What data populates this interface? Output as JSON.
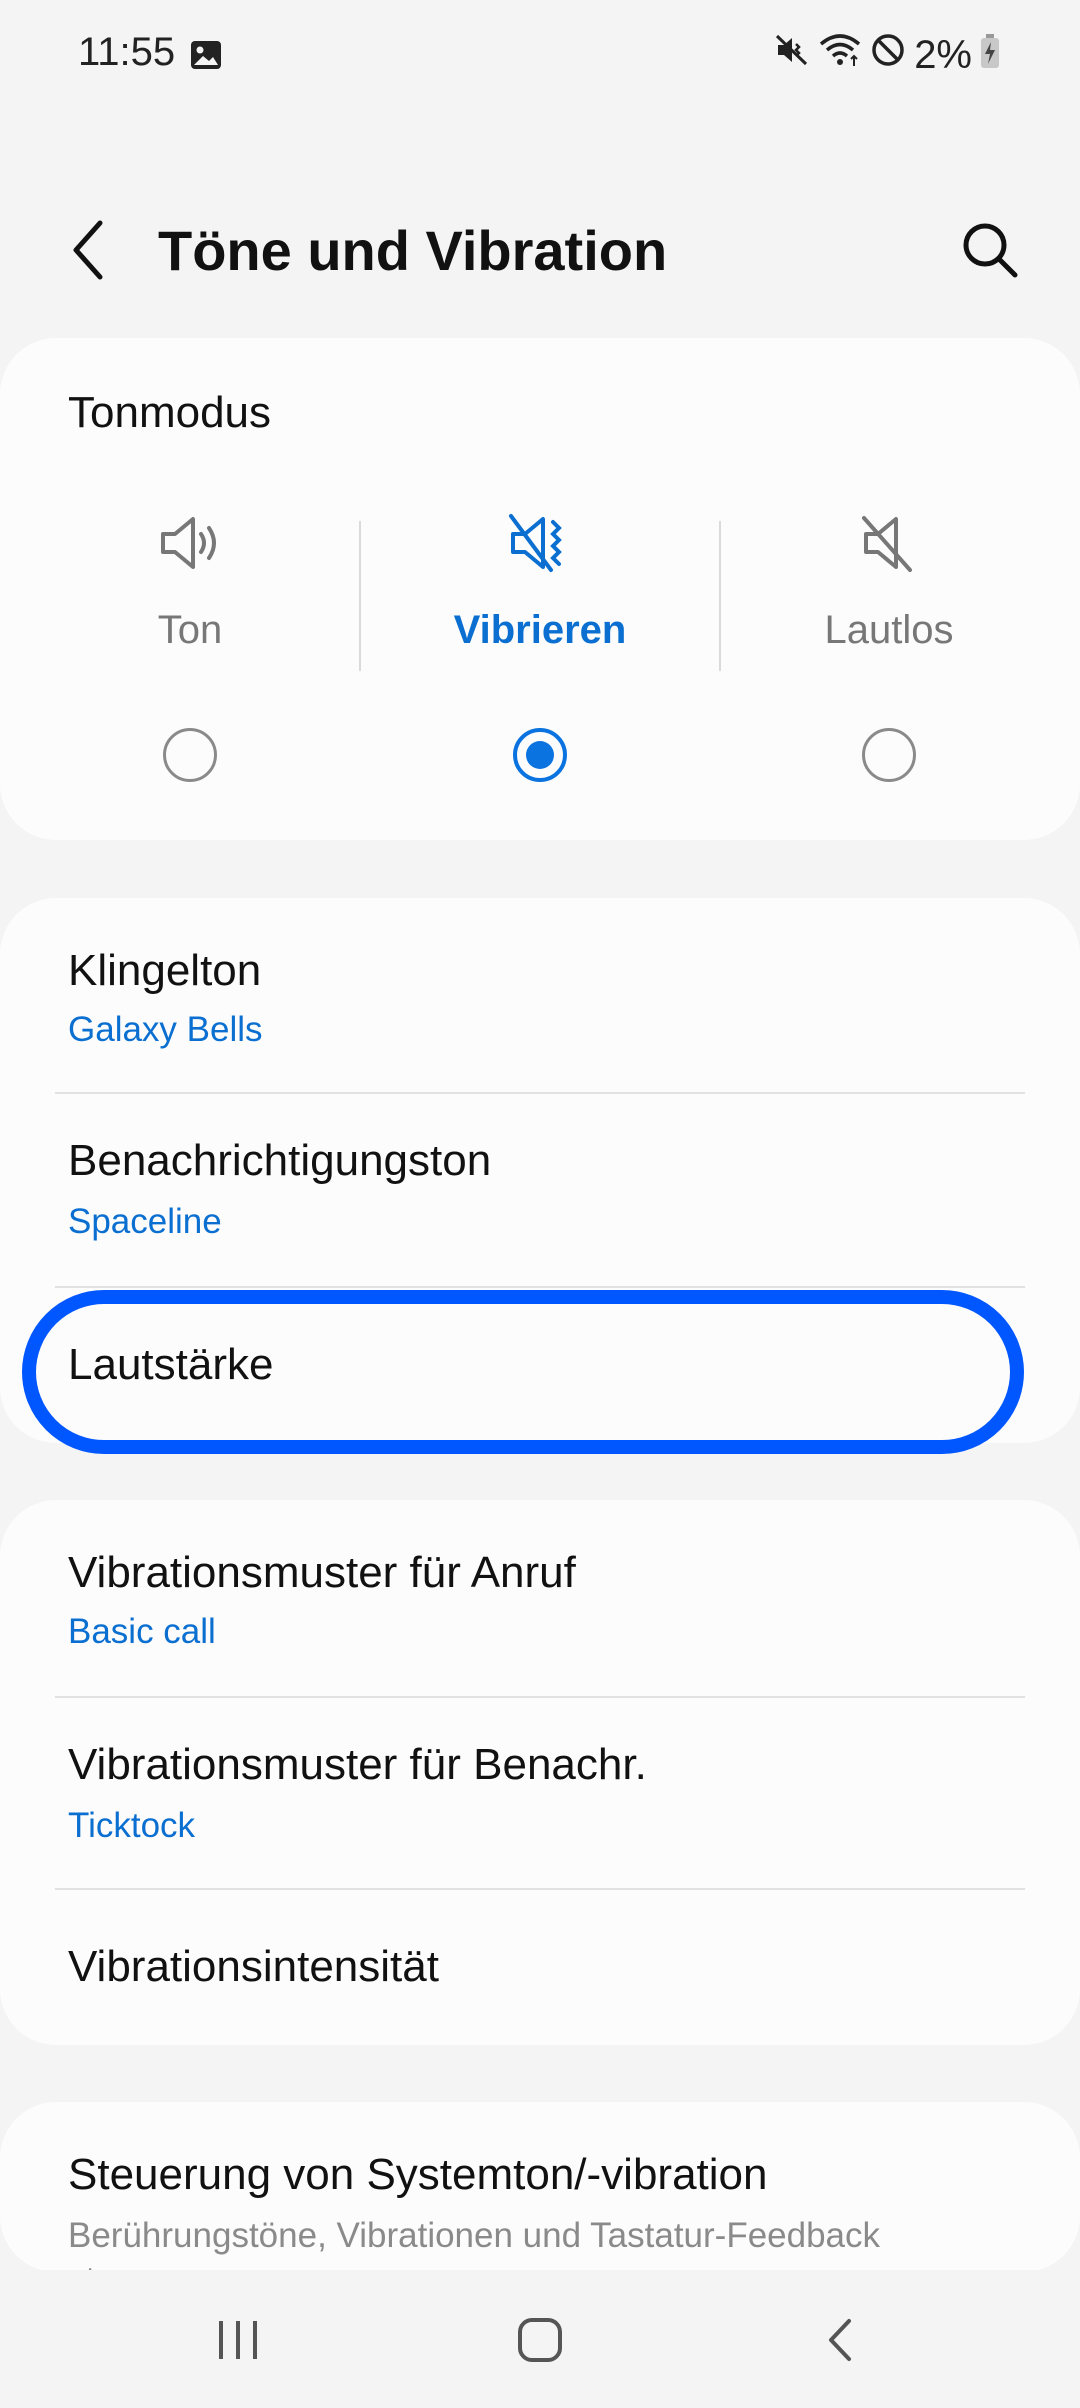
{
  "status": {
    "time": "11:55",
    "battery": "2%",
    "icons": [
      "gallery-icon",
      "mute-vibrate-icon",
      "wifi-icon",
      "no-disturb-icon",
      "battery-charging-icon"
    ]
  },
  "header": {
    "title": "Töne und Vibration",
    "back_icon": "back-arrow-icon",
    "search_icon": "search-icon"
  },
  "sound_mode": {
    "heading": "Tonmodus",
    "options": [
      {
        "label": "Ton",
        "icon": "speaker-icon",
        "selected": false
      },
      {
        "label": "Vibrieren",
        "icon": "vibrate-icon",
        "selected": true
      },
      {
        "label": "Lautlos",
        "icon": "mute-icon",
        "selected": false
      }
    ]
  },
  "group1": [
    {
      "title": "Klingelton",
      "subtitle": "Galaxy Bells"
    },
    {
      "title": "Benachrichtigungston",
      "subtitle": "Spaceline"
    },
    {
      "title": "Lautstärke"
    }
  ],
  "group2": [
    {
      "title": "Vibrationsmuster für Anruf",
      "subtitle": "Basic call"
    },
    {
      "title": "Vibrationsmuster für Benachr.",
      "subtitle": "Ticktock"
    },
    {
      "title": "Vibrationsintensität"
    }
  ],
  "group3": [
    {
      "title": "Steuerung von Systemton/-vibration",
      "subtitle": "Berührungstöne, Vibrationen und Tastatur-Feedback steuern"
    }
  ],
  "colors": {
    "accent": "#0a6fd0",
    "highlight": "#0057ff"
  },
  "nav": {
    "icons": [
      "recents-icon",
      "home-icon",
      "back-icon"
    ]
  }
}
